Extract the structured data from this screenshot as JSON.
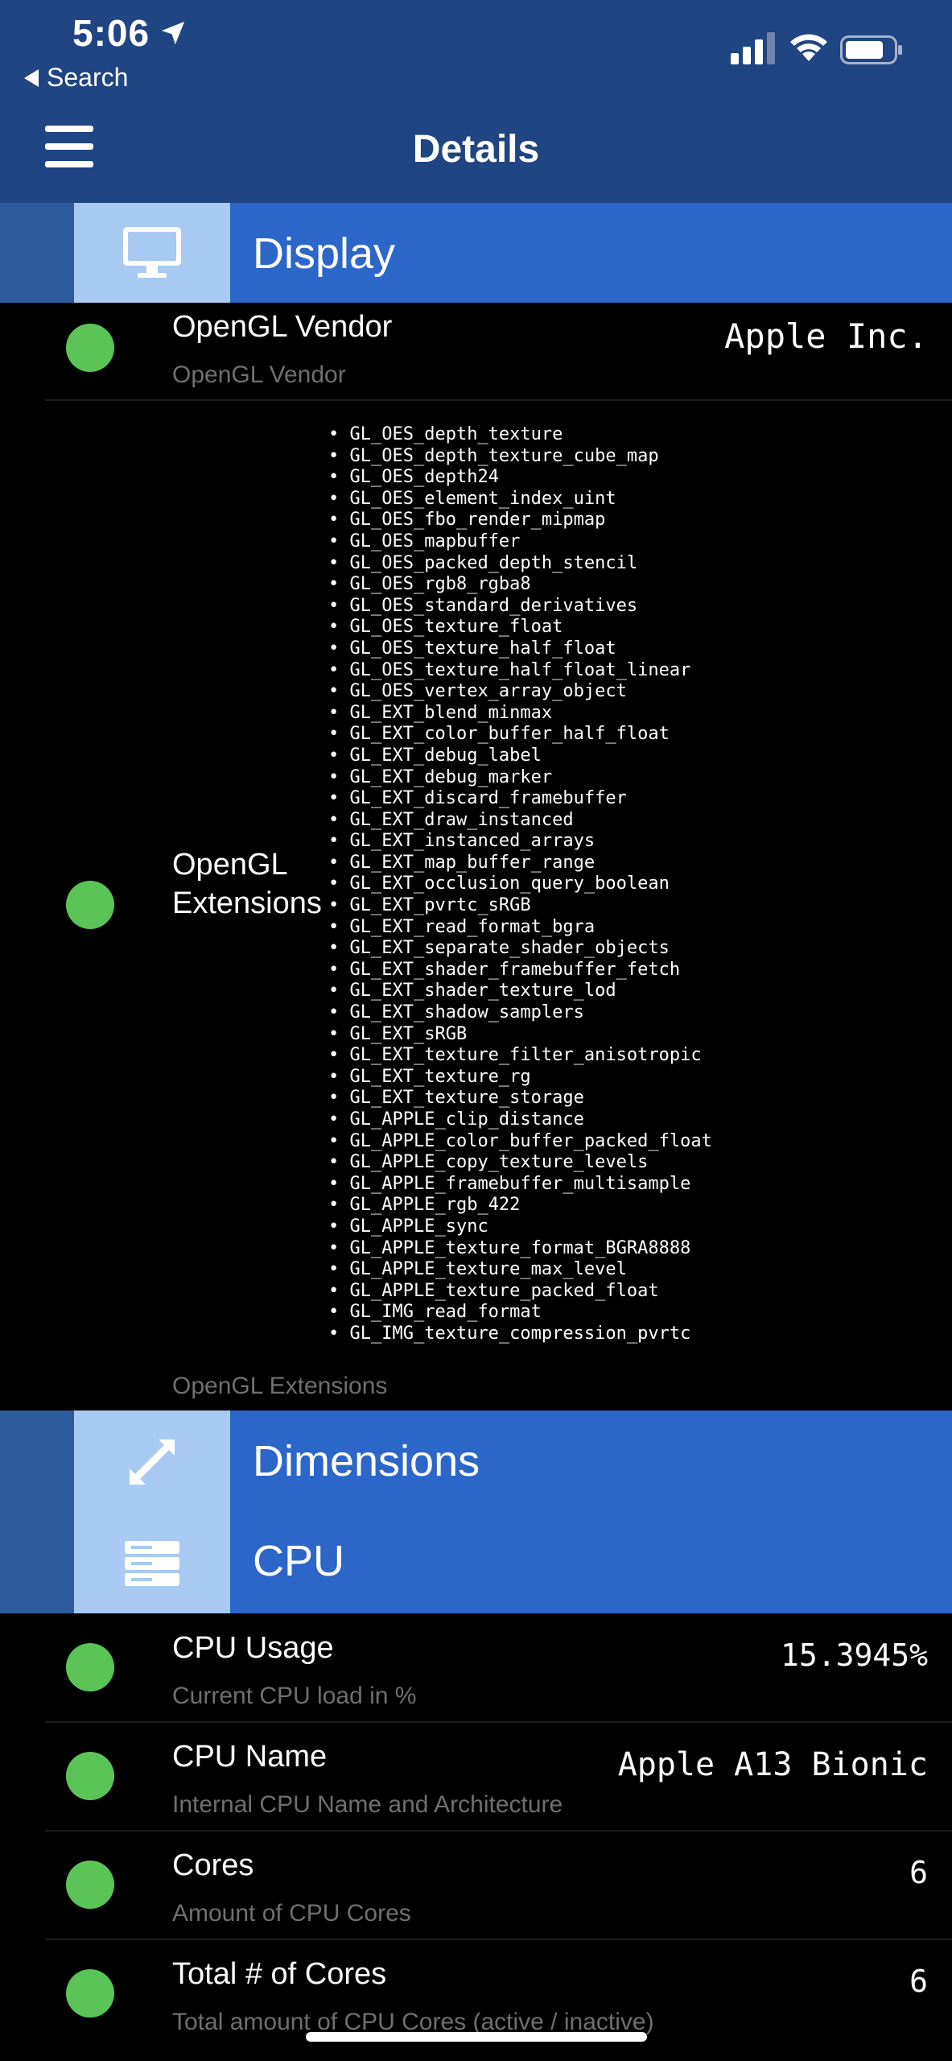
{
  "status_bar": {
    "time": "5:06"
  },
  "nav": {
    "back_label": "Search",
    "title": "Details"
  },
  "sections": {
    "display": "Display",
    "dimensions": "Dimensions",
    "cpu": "CPU"
  },
  "display_rows": {
    "vendor": {
      "title": "OpenGL Vendor",
      "subtitle": "OpenGL Vendor",
      "value": "Apple Inc."
    },
    "extensions": {
      "title_line1": "OpenGL",
      "title_line2": "Extensions",
      "subtitle": "OpenGL Extensions",
      "items": [
        "GL_OES_depth_texture",
        "GL_OES_depth_texture_cube_map",
        "GL_OES_depth24",
        "GL_OES_element_index_uint",
        "GL_OES_fbo_render_mipmap",
        "GL_OES_mapbuffer",
        "GL_OES_packed_depth_stencil",
        "GL_OES_rgb8_rgba8",
        "GL_OES_standard_derivatives",
        "GL_OES_texture_float",
        "GL_OES_texture_half_float",
        "GL_OES_texture_half_float_linear",
        "GL_OES_vertex_array_object",
        "GL_EXT_blend_minmax",
        "GL_EXT_color_buffer_half_float",
        "GL_EXT_debug_label",
        "GL_EXT_debug_marker",
        "GL_EXT_discard_framebuffer",
        "GL_EXT_draw_instanced",
        "GL_EXT_instanced_arrays",
        "GL_EXT_map_buffer_range",
        "GL_EXT_occlusion_query_boolean",
        "GL_EXT_pvrtc_sRGB",
        "GL_EXT_read_format_bgra",
        "GL_EXT_separate_shader_objects",
        "GL_EXT_shader_framebuffer_fetch",
        "GL_EXT_shader_texture_lod",
        "GL_EXT_shadow_samplers",
        "GL_EXT_sRGB",
        "GL_EXT_texture_filter_anisotropic",
        "GL_EXT_texture_rg",
        "GL_EXT_texture_storage",
        "GL_APPLE_clip_distance",
        "GL_APPLE_color_buffer_packed_float",
        "GL_APPLE_copy_texture_levels",
        "GL_APPLE_framebuffer_multisample",
        "GL_APPLE_rgb_422",
        "GL_APPLE_sync",
        "GL_APPLE_texture_format_BGRA8888",
        "GL_APPLE_texture_max_level",
        "GL_APPLE_texture_packed_float",
        "GL_IMG_read_format",
        "GL_IMG_texture_compression_pvrtc"
      ]
    }
  },
  "cpu_rows": [
    {
      "title": "CPU Usage",
      "subtitle": "Current CPU load in %",
      "value": "15.3945%"
    },
    {
      "title": "CPU Name",
      "subtitle": "Internal CPU Name and Architecture",
      "value": "Apple A13 Bionic"
    },
    {
      "title": "Cores",
      "subtitle": "Amount of CPU Cores",
      "value": "6"
    },
    {
      "title": "Total # of Cores",
      "subtitle": "Total amount of CPU Cores (active / inactive)",
      "value": "6"
    }
  ],
  "icons": {
    "location": "location-arrow-icon",
    "signal": "cellular-signal-icon",
    "wifi": "wifi-icon",
    "battery": "battery-icon",
    "menu": "hamburger-menu-icon",
    "display": "monitor-icon",
    "dimensions": "expand-arrows-icon",
    "cpu": "server-stack-icon"
  },
  "colors": {
    "nav_bg": "#1f4582",
    "section_bar": "#2c66c8",
    "section_icon_bg": "#a9caf2",
    "status_dot": "#5bc456"
  }
}
